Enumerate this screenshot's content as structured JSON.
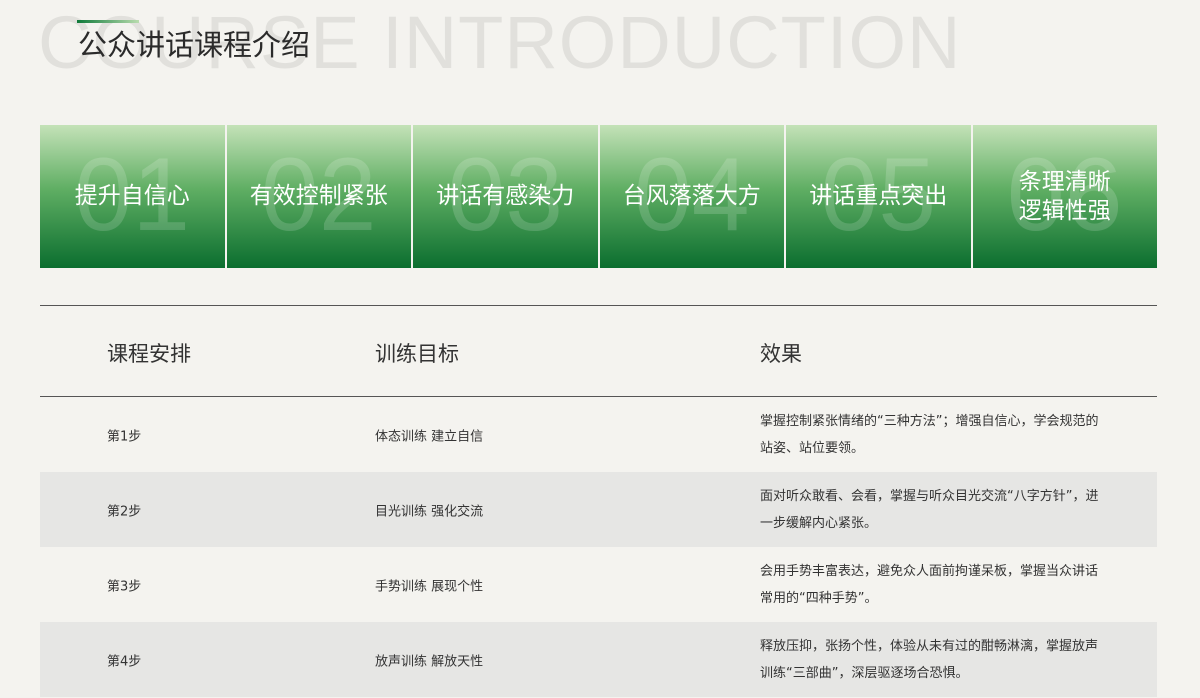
{
  "header": {
    "bg_text": "COURSE INTRODUCTION",
    "title": "公众讲话课程介绍"
  },
  "cards": [
    {
      "num": "01",
      "label": "提升自信心"
    },
    {
      "num": "02",
      "label": "有效控制紧张"
    },
    {
      "num": "03",
      "label": "讲话有感染力"
    },
    {
      "num": "04",
      "label": "台风落落大方"
    },
    {
      "num": "05",
      "label": "讲话重点突出"
    },
    {
      "num": "06",
      "label": "条理清晰\n逻辑性强"
    }
  ],
  "table": {
    "headers": [
      "课程安排",
      "训练目标",
      "效果"
    ],
    "rows": [
      {
        "step": "第1步",
        "goal": "体态训练 建立自信",
        "effect": "掌握控制紧张情绪的“三种方法”；增强自信心，学会规范的站姿、站位要领。"
      },
      {
        "step": "第2步",
        "goal": "目光训练 强化交流",
        "effect": "面对听众敢看、会看，掌握与听众目光交流“八字方针”，进一步缓解内心紧张。"
      },
      {
        "step": "第3步",
        "goal": "手势训练 展现个性",
        "effect": "会用手势丰富表达，避免众人面前拘谨呆板，掌握当众讲话常用的“四种手势”。"
      },
      {
        "step": "第4步",
        "goal": "放声训练 解放天性",
        "effect": "释放压抑，张扬个性，体验从未有过的酣畅淋漓，掌握放声训练“三部曲”，深层驱逐场合恐惧。"
      }
    ]
  }
}
